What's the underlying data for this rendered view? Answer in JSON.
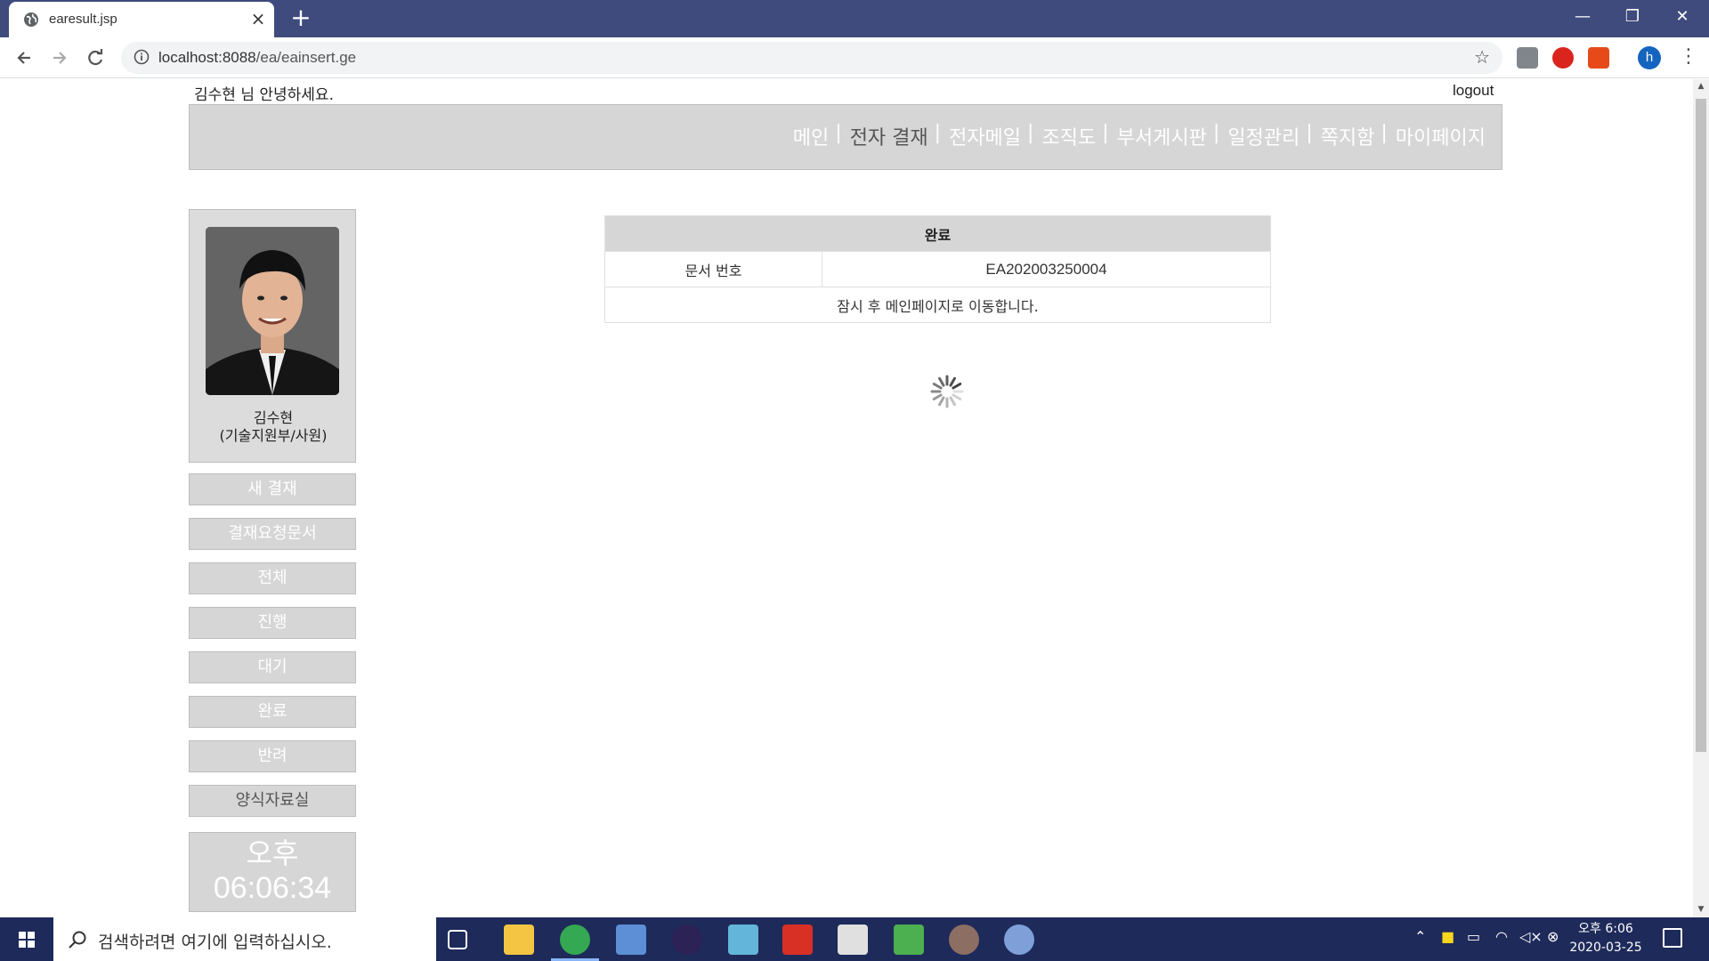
{
  "browser": {
    "tab_title": "earesult.jsp",
    "tab_close": "×",
    "new_tab": "+",
    "url_host": "localhost:8088",
    "url_path": "/ea/eainsert.ge",
    "profile_initial": "h",
    "window_controls": {
      "minimize": "—",
      "restore": "❐",
      "close": "✕"
    }
  },
  "header": {
    "greeting": "김수현 님 안녕하세요.",
    "logout": "logout"
  },
  "nav": {
    "items": [
      "메인",
      "전자 결재",
      "전자메일",
      "조직도",
      "부서게시판",
      "일정관리",
      "쪽지함",
      "마이페이지"
    ],
    "separator": "|",
    "active_index": 1
  },
  "profile": {
    "name": "김수현",
    "dept": "(기술지원부/사원)"
  },
  "sidebar": {
    "buttons": [
      "새 결재",
      "결재요청문서",
      "전체",
      "진행",
      "대기",
      "완료",
      "반려",
      "양식자료실"
    ]
  },
  "clock": {
    "ampm": "오후",
    "time": "06:06:34"
  },
  "result": {
    "header": "완료",
    "doc_label": "문서 번호",
    "doc_number": "EA202003250004",
    "message": "잠시 후 메인페이지로 이동합니다."
  },
  "taskbar": {
    "search_placeholder": "검색하려면 여기에 입력하십시오.",
    "time_ampm": "오후 6:06",
    "date": "2020-03-25"
  },
  "colors": {
    "chrome_frame": "#3f4b7c",
    "nav_bg": "#d6d6d6",
    "taskbar": "#1e2a5a"
  }
}
